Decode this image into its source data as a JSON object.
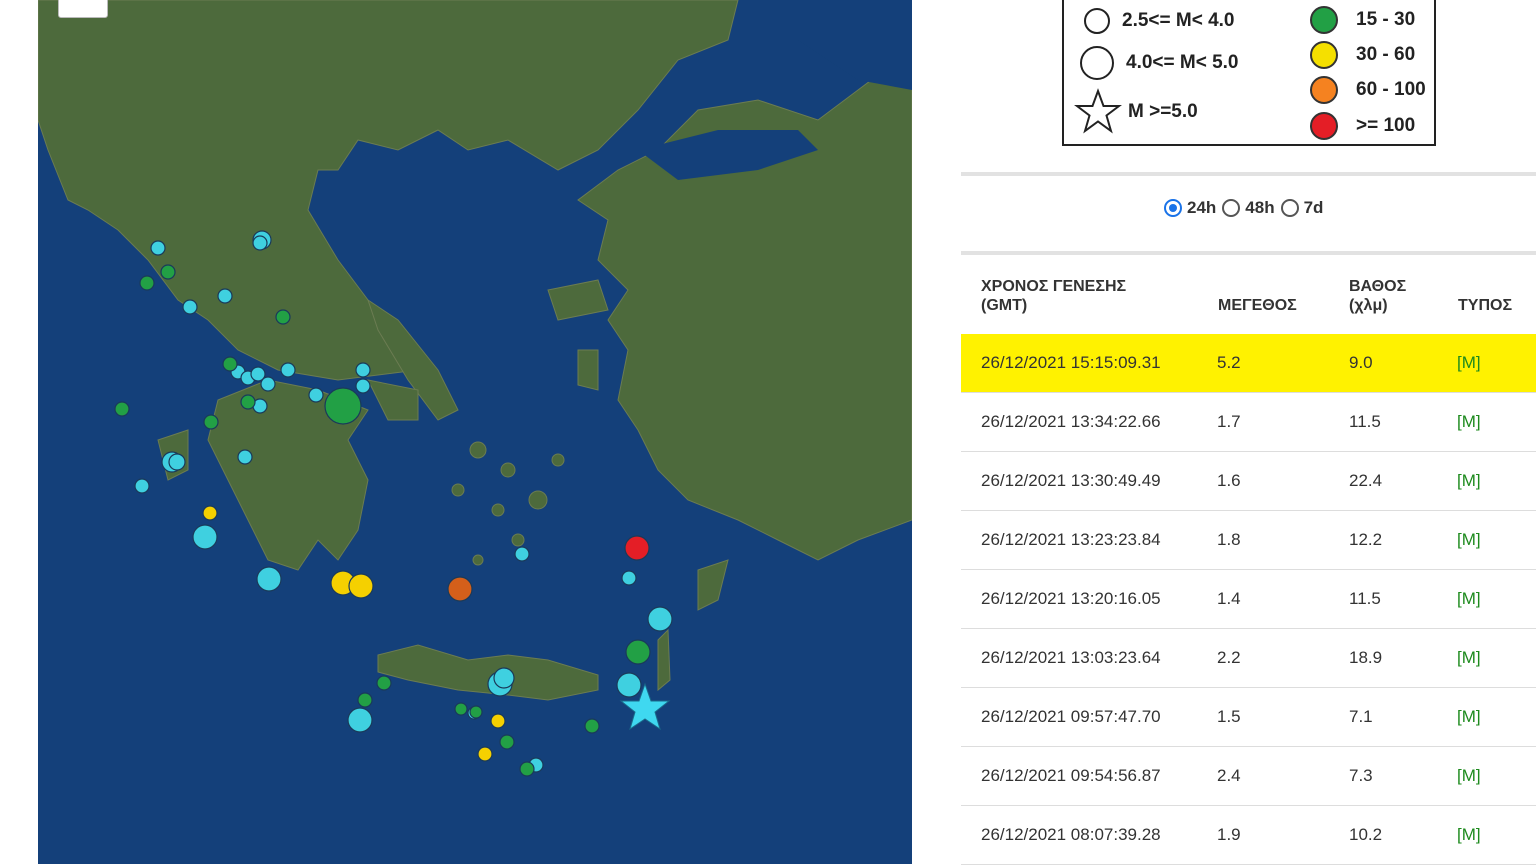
{
  "legend": {
    "magnitude": [
      {
        "label": "2.5<= M< 4.0",
        "symbol": "circle-small"
      },
      {
        "label": "4.0<= M< 5.0",
        "symbol": "circle-medium"
      },
      {
        "label": "M >=5.0",
        "symbol": "star"
      }
    ],
    "depth": [
      {
        "label": "15 - 30",
        "color": "#22a045"
      },
      {
        "label": "30 - 60",
        "color": "#f5e000"
      },
      {
        "label": "60 - 100",
        "color": "#f58220"
      },
      {
        "label": ">= 100",
        "color": "#e41e26"
      }
    ]
  },
  "time_filter": {
    "options": [
      {
        "label": "24h",
        "checked": true
      },
      {
        "label": "48h",
        "checked": false
      },
      {
        "label": "7d",
        "checked": false
      }
    ]
  },
  "table": {
    "headers": {
      "time_line1": "ΧΡΟΝΟΣ ΓΕΝΕΣΗΣ",
      "time_line2": "(GMT)",
      "magnitude": "ΜΕΓΕΘΟΣ",
      "depth_line1": "ΒΑΘΟΣ",
      "depth_line2": "(χλμ)",
      "type": "ΤΥΠΟΣ"
    },
    "rows": [
      {
        "time": "26/12/2021 15:15:09.31",
        "magnitude": "5.2",
        "depth": "9.0",
        "type": "[M]",
        "highlight": true
      },
      {
        "time": "26/12/2021 13:34:22.66",
        "magnitude": "1.7",
        "depth": "11.5",
        "type": "[M]"
      },
      {
        "time": "26/12/2021 13:30:49.49",
        "magnitude": "1.6",
        "depth": "22.4",
        "type": "[M]"
      },
      {
        "time": "26/12/2021 13:23:23.84",
        "magnitude": "1.8",
        "depth": "12.2",
        "type": "[M]"
      },
      {
        "time": "26/12/2021 13:20:16.05",
        "magnitude": "1.4",
        "depth": "11.5",
        "type": "[M]"
      },
      {
        "time": "26/12/2021 13:03:23.64",
        "magnitude": "2.2",
        "depth": "18.9",
        "type": "[M]"
      },
      {
        "time": "26/12/2021 09:57:47.70",
        "magnitude": "1.5",
        "depth": "7.1",
        "type": "[M]"
      },
      {
        "time": "26/12/2021 09:54:56.87",
        "magnitude": "2.4",
        "depth": "7.3",
        "type": "[M]"
      },
      {
        "time": "26/12/2021 08:07:39.28",
        "magnitude": "1.9",
        "depth": "10.2",
        "type": "[M]"
      }
    ]
  },
  "colors": {
    "shallow": "#3fd0e0",
    "green": "#22a045",
    "yellow": "#f5d000",
    "orange": "#d45f1a",
    "red": "#e41e26",
    "star": "#3fd8f0",
    "highlight_row": "#fff200",
    "type_text": "#1d8a1d"
  }
}
